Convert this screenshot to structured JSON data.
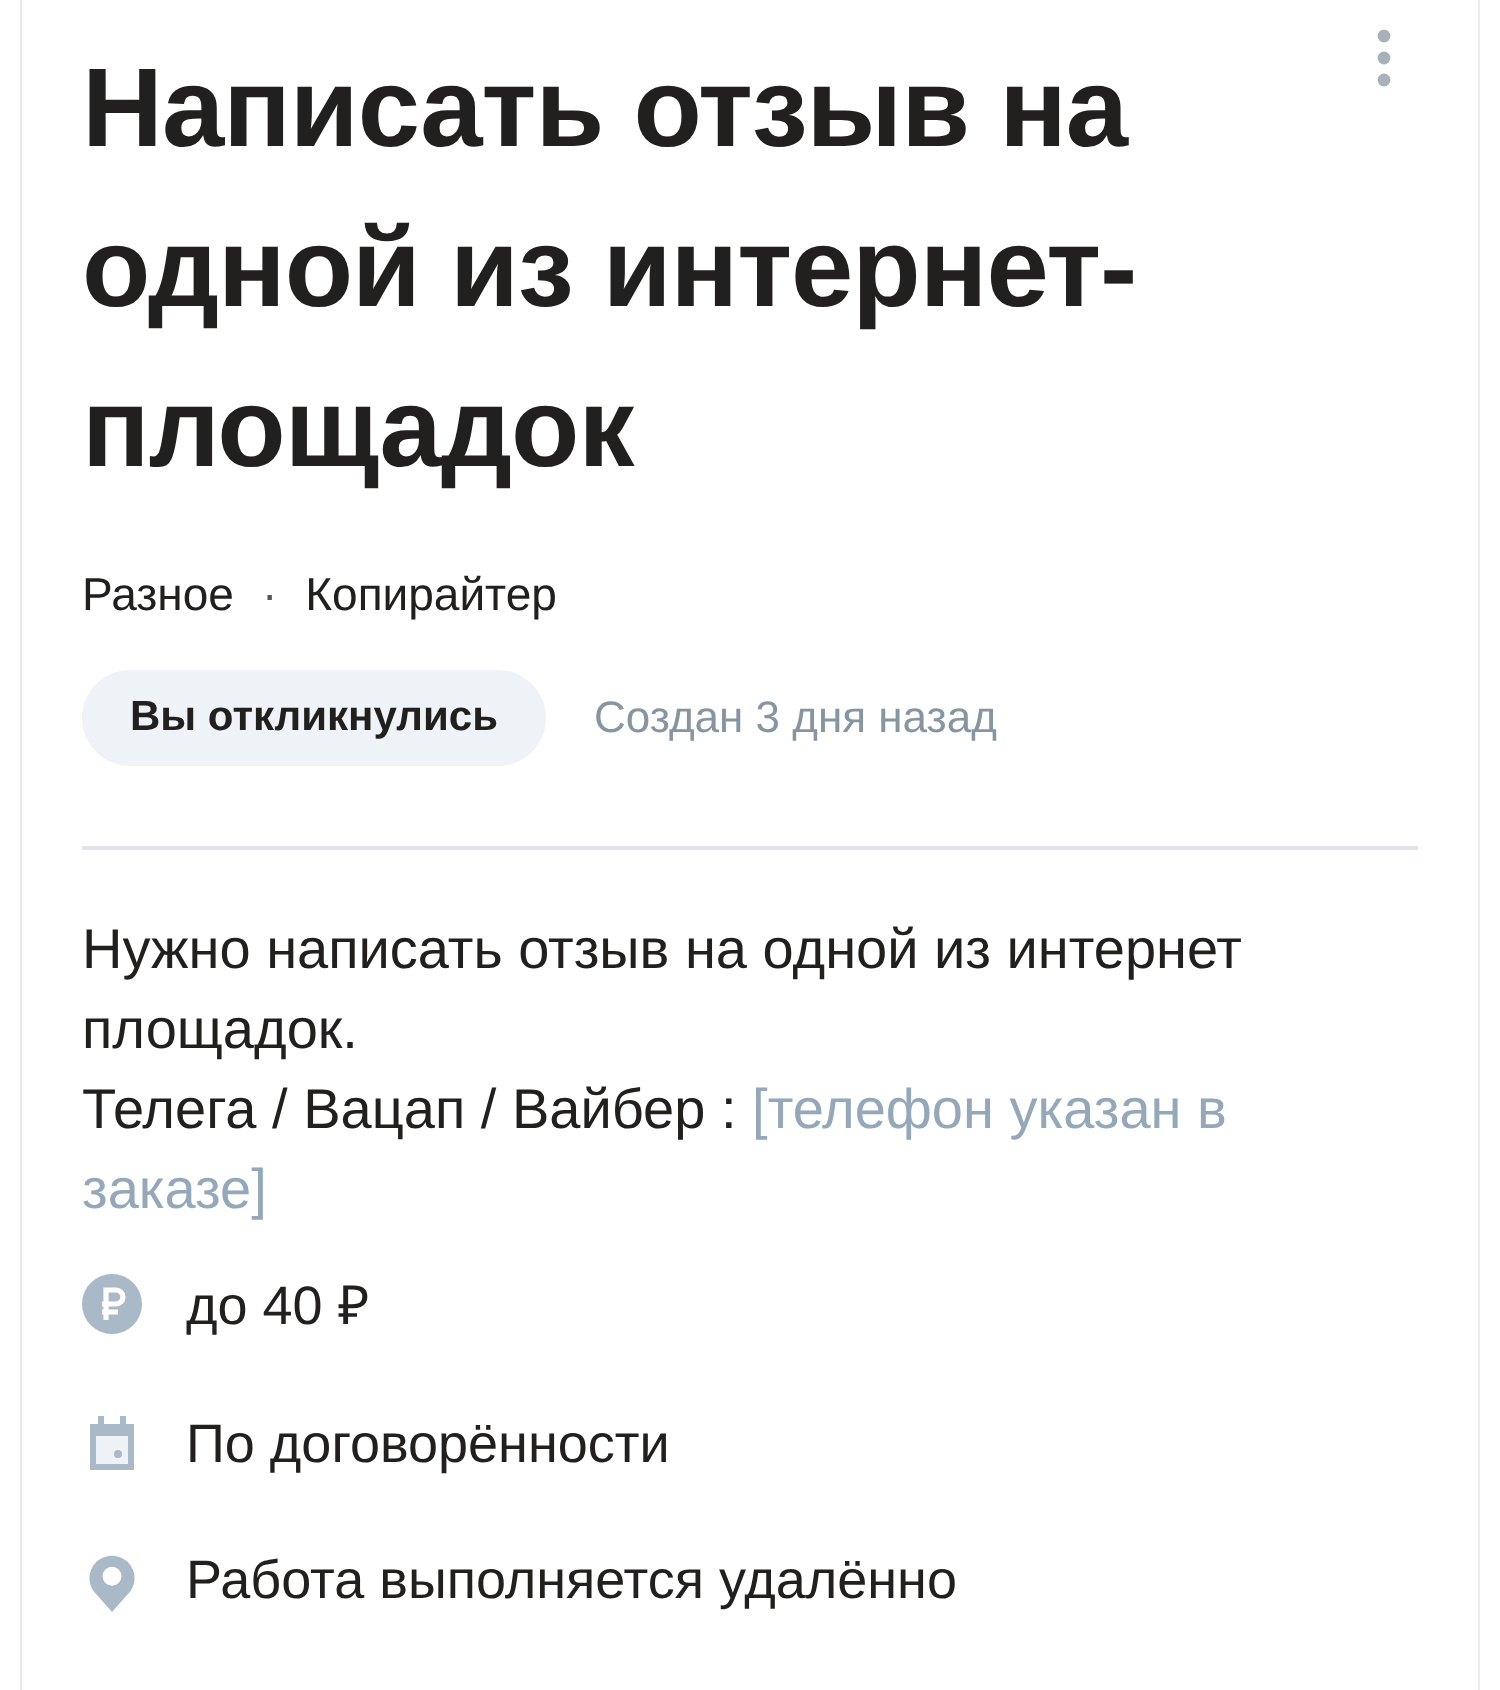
{
  "title": "Написать отзыв на одной из интернет-площадок",
  "categories": [
    "Разное",
    "Копирайтер"
  ],
  "separator": "·",
  "status_badge": "Вы откликнулись",
  "created": "Создан 3 дня назад",
  "description": {
    "text": "Нужно написать отзыв на одной из интернет площадок.",
    "contacts_label": "Телега / Вацап / Вайбер :",
    "contacts_hidden": "[телефон указан в заказе]"
  },
  "details": [
    {
      "kind": "price",
      "text": "до 40 ₽"
    },
    {
      "kind": "date",
      "text": "По договорённости"
    },
    {
      "kind": "location",
      "text": "Работа выполняется удалённо"
    }
  ]
}
